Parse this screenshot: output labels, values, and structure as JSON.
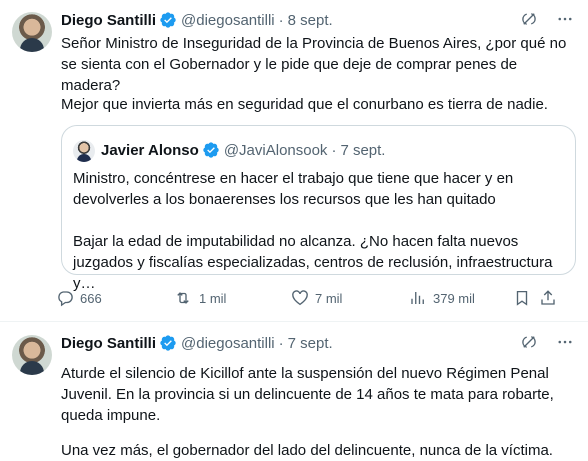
{
  "tweets": [
    {
      "author": {
        "name": "Diego Santilli",
        "handle": "@diegosantilli",
        "date": "8 sept."
      },
      "text_p1": "Señor Ministro de Inseguridad de la Provincia de Buenos Aires, ¿por qué no se sienta con el Gobernador y le pide que deje de comprar penes de madera?",
      "text_p2": "Mejor que invierta más en seguridad que el conurbano es tierra de nadie.",
      "quote": {
        "author": {
          "name": "Javier Alonso",
          "handle": "@JaviAlonsook",
          "date": "7 sept."
        },
        "text_p1": "Ministro, concéntrese en hacer el trabajo que tiene que hacer y en devolverles a los bonaerenses los recursos que les han quitado",
        "text_p2": "Bajar la edad de imputabilidad no alcanza. ¿No hacen falta nuevos juzgados y fiscalías especializadas, centros de reclusión, infraestructura y…"
      },
      "metrics": {
        "replies": "666",
        "reposts": "1 mil",
        "likes": "7 mil",
        "views": "379 mil"
      }
    },
    {
      "author": {
        "name": "Diego Santilli",
        "handle": "@diegosantilli",
        "date": "7 sept."
      },
      "text_p1": "Aturde el silencio de Kicillof ante la suspensión del nuevo Régimen Penal Juvenil. En la provincia si un delincuente de 14 años te mata para robarte, queda impune.",
      "text_p2": "Una vez más, el gobernador del lado del delincuente, nunca de la víctima."
    }
  ],
  "separator": "·",
  "icons": {
    "verified": "verified-badge-icon",
    "grok": "grok-icon",
    "more": "more-icon",
    "reply": "reply-icon",
    "repost": "repost-icon",
    "like": "like-icon",
    "views": "views-icon",
    "bookmark": "bookmark-icon",
    "share": "share-icon"
  },
  "colors": {
    "verified": "#1d9bf0",
    "muted": "#536471",
    "text": "#0f1419",
    "border": "#cfd9de"
  }
}
